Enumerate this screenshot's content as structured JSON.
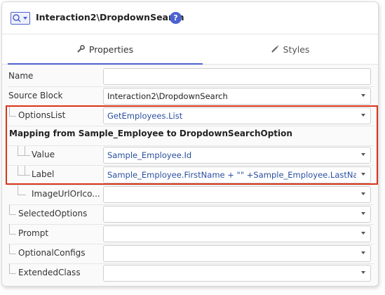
{
  "header": {
    "title": "Interaction2\\DropdownSearch",
    "widget_icon": "dropdown-search-widget-icon",
    "help_icon": "help-icon",
    "help_glyph": "?"
  },
  "tabs": [
    {
      "label": "Properties",
      "icon": "wrench-icon",
      "active": true
    },
    {
      "label": "Styles",
      "icon": "brush-icon",
      "active": false
    }
  ],
  "properties": {
    "name": {
      "label": "Name",
      "value": ""
    },
    "source_block": {
      "label": "Source Block",
      "value": "Interaction2\\DropdownSearch"
    },
    "options_list": {
      "label": "OptionsList",
      "value": "GetEmployees.List"
    },
    "mapping_heading": "Mapping from Sample_Employee to DropdownSearchOption",
    "value": {
      "label": "Value",
      "value": "Sample_Employee.Id"
    },
    "label": {
      "label": "Label",
      "value": "Sample_Employee.FirstName + \"\" +Sample_Employee.LastName"
    },
    "image_url": {
      "label": "ImageUrlOrIco...",
      "value": ""
    },
    "selected_options": {
      "label": "SelectedOptions",
      "value": ""
    },
    "prompt": {
      "label": "Prompt",
      "value": ""
    },
    "optional_configs": {
      "label": "OptionalConfigs",
      "value": ""
    },
    "extended_class": {
      "label": "ExtendedClass",
      "value": ""
    }
  },
  "colors": {
    "accent": "#4b62d0",
    "highlight_border": "#d9331a",
    "expression_text": "#2a4fa0"
  }
}
